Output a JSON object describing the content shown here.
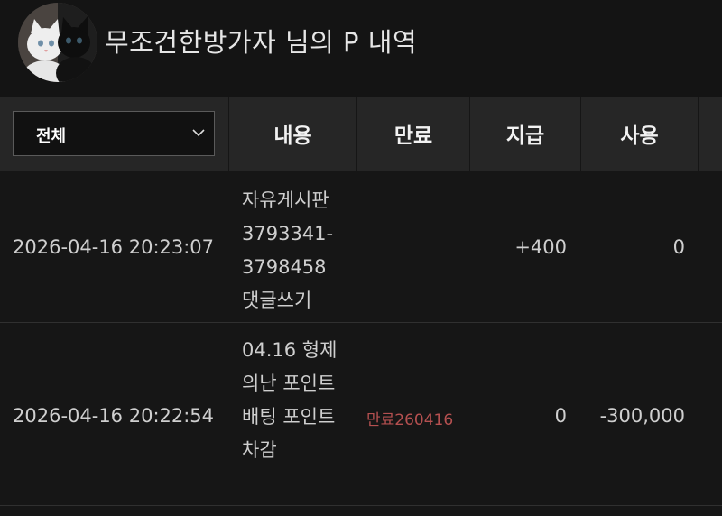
{
  "header": {
    "title": "무조건한방가자 님의 P 내역",
    "avatar_alt": "profile-avatar"
  },
  "filter": {
    "selected": "전체"
  },
  "columns": {
    "content": "내용",
    "expire": "만료",
    "earn": "지급",
    "use": "사용"
  },
  "rows": [
    {
      "datetime": "2026-04-16 20:23:07",
      "content": "자유게시판 3793341-3798458 댓글쓰기",
      "expire": "",
      "earn": "+400",
      "use": "0"
    },
    {
      "datetime": "2026-04-16 20:22:54",
      "content": "04.16 형제의난 포인트 배팅 포인트 차감",
      "expire": "만료260416",
      "earn": "0",
      "use": "-300,000"
    }
  ],
  "colors": {
    "background": "#161616",
    "header_row": "#262626",
    "expire_text": "#b55050"
  }
}
